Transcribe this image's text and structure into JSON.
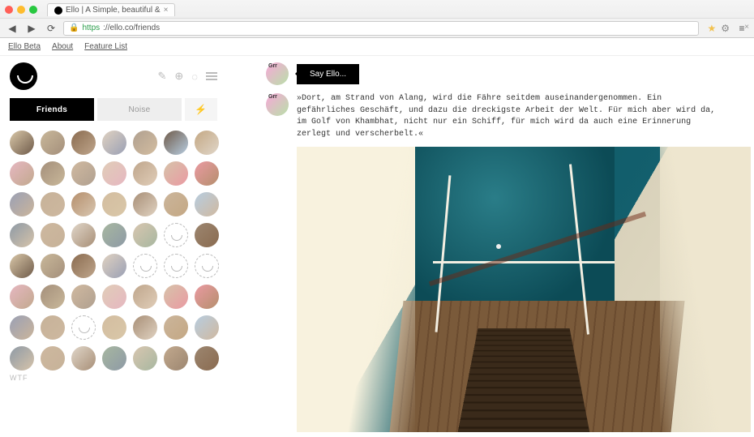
{
  "browser": {
    "tab_title": "Ello | A Simple, beautiful &",
    "url_scheme": "https",
    "url_host_path": "://ello.co/friends"
  },
  "bookmarks": {
    "items": [
      "Ello Beta",
      "About",
      "Feature List"
    ]
  },
  "sidebar": {
    "tabs": {
      "friends": "Friends",
      "noise": "Noise",
      "bolt": "⚡"
    },
    "footer": "WTF"
  },
  "logo_icons": {
    "pencil": "pencil-icon",
    "add": "add-icon",
    "discover": "discover-icon",
    "menu": "menu-icon"
  },
  "avatars": {
    "count": 56,
    "placeholders": [
      26,
      32,
      33,
      34,
      44
    ]
  },
  "composer": {
    "prompt": "Say Ello..."
  },
  "post": {
    "text": "»Dort, am Strand von Alang, wird die Fähre seitdem auseinandergenommen. Ein gefährliches Geschäft, und dazu die dreckigste Arbeit der Welt. Für mich aber wird da, im Golf von Khambhat, nicht nur ein Schiff, für mich wird da auch eine Erinnerung zerlegt und verscherbelt.«"
  }
}
